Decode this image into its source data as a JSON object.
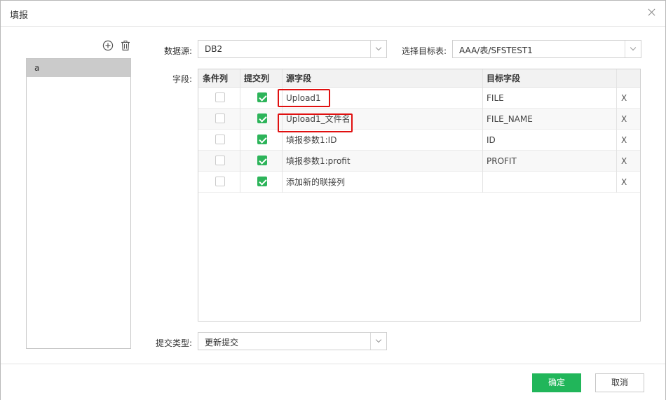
{
  "dialog": {
    "title": "填报"
  },
  "list": {
    "items": [
      {
        "label": "a"
      }
    ]
  },
  "form": {
    "datasource_label": "数据源:",
    "datasource_value": "DB2",
    "target_label": "选择目标表:",
    "target_value": "AAA/表/SFSTEST1",
    "fields_label": "字段:",
    "submit_type_label": "提交类型:",
    "submit_type_value": "更新提交"
  },
  "table": {
    "headers": {
      "condition": "条件列",
      "submit": "提交列",
      "source": "源字段",
      "target": "目标字段"
    },
    "rows": [
      {
        "condition": false,
        "submit": true,
        "source": "Upload1",
        "target": "FILE",
        "delete": "X",
        "highlighted": true
      },
      {
        "condition": false,
        "submit": true,
        "source": "Upload1_文件名",
        "target": "FILE_NAME",
        "delete": "X",
        "highlighted": true
      },
      {
        "condition": false,
        "submit": true,
        "source": "填报参数1:ID",
        "target": "ID",
        "delete": "X",
        "highlighted": false
      },
      {
        "condition": false,
        "submit": true,
        "source": "填报参数1:profit",
        "target": "PROFIT",
        "delete": "X",
        "highlighted": false
      },
      {
        "condition": false,
        "submit": true,
        "source": "添加新的联接列",
        "target": "",
        "delete": "X",
        "highlighted": false
      }
    ]
  },
  "footer": {
    "ok_label": "确定",
    "cancel_label": "取消"
  },
  "colors": {
    "accent": "#21b65a",
    "highlight_border": "#e01010",
    "selected_item": "#cbcbcb"
  }
}
